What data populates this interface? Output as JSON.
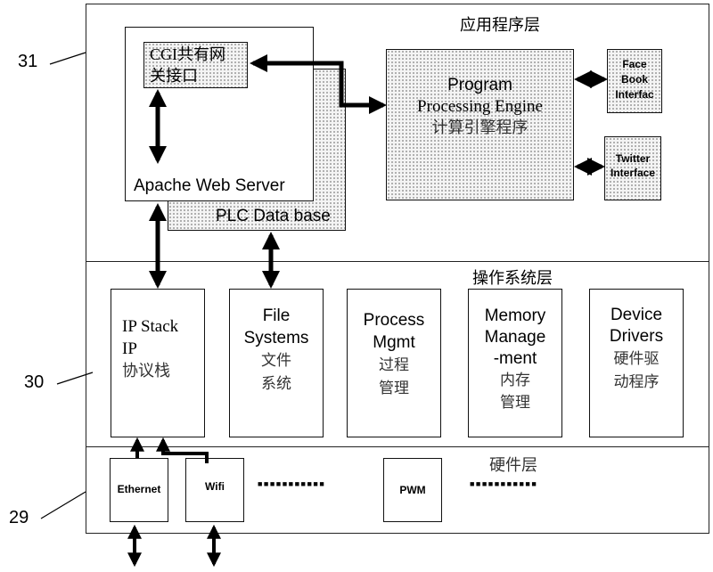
{
  "reference_labels": {
    "app_layer": "31",
    "os_layer": "30",
    "hw_layer": "29"
  },
  "app_layer": {
    "title": "应用程序层",
    "apache": {
      "label": "Apache Web Server",
      "cgi": {
        "line1": "CGI共有网",
        "line2": "关接口"
      }
    },
    "plc_db": {
      "label": "PLC Data base"
    },
    "engine": {
      "line1": "Program",
      "line2": "Processing Engine",
      "line3": "计算引擎程序"
    },
    "facebook": {
      "line1": "Face",
      "line2": "Book",
      "line3": "Interfac"
    },
    "twitter": {
      "line1": "Twitter",
      "line2": "Interface"
    }
  },
  "os_layer": {
    "title": "操作系统层",
    "modules": [
      {
        "lines": [
          "IP Stack",
          "IP",
          "协议栈"
        ]
      },
      {
        "lines": [
          "File",
          "Systems",
          "文件",
          "系统"
        ]
      },
      {
        "lines": [
          "Process",
          "Mgmt",
          "过程",
          "管理"
        ]
      },
      {
        "lines": [
          "Memory",
          "Manage",
          "-ment",
          "内存",
          "管理"
        ]
      },
      {
        "lines": [
          "Device",
          "Drivers",
          "硬件驱",
          "动程序"
        ]
      }
    ]
  },
  "hw_layer": {
    "title": "硬件层",
    "modules": [
      {
        "label": "Ethernet"
      },
      {
        "label": "Wifi"
      },
      {
        "label": "PWM"
      }
    ],
    "ellipsis": "■■■■■■■■■■■"
  }
}
